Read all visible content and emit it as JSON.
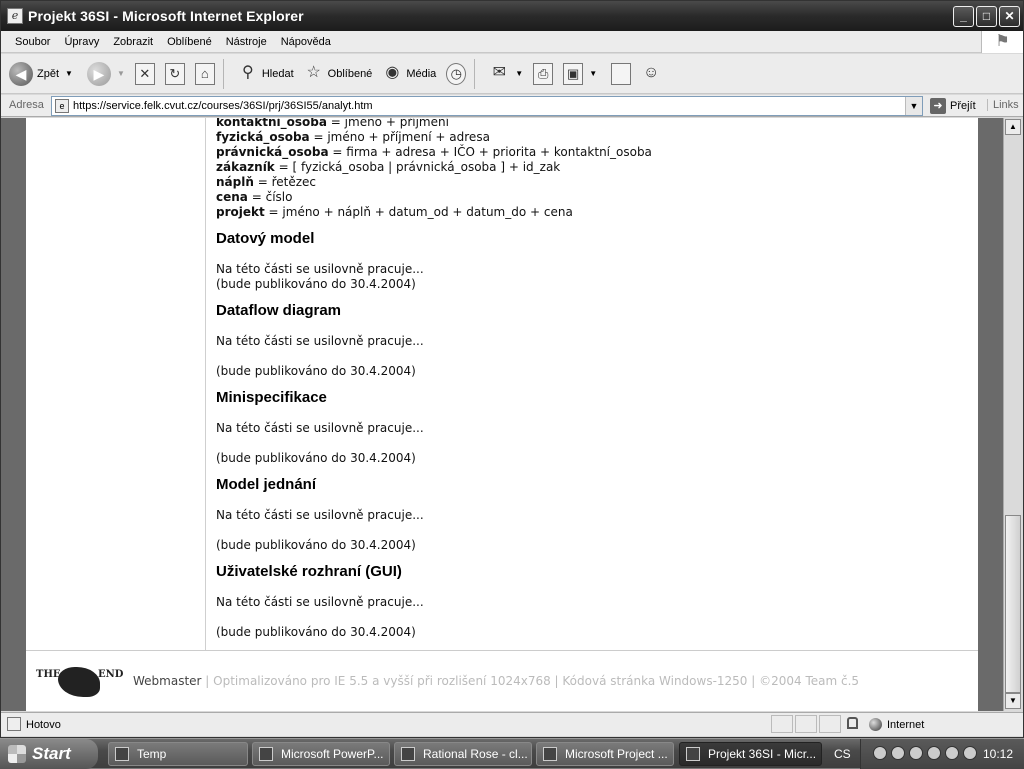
{
  "window": {
    "title": "Projekt 36SI - Microsoft Internet Explorer"
  },
  "menu": [
    "Soubor",
    "Úpravy",
    "Zobrazit",
    "Oblíbené",
    "Nástroje",
    "Nápověda"
  ],
  "toolbar": {
    "back": "Zpět",
    "search": "Hledat",
    "favorites": "Oblíbené",
    "media": "Média"
  },
  "address": {
    "label": "Adresa",
    "url": "https://service.felk.cvut.cz/courses/36SI/prj/36SI55/analyt.htm",
    "go": "Přejít",
    "links": "Links"
  },
  "content": {
    "definitions": [
      {
        "term": "kontaktní_osoba",
        "def": " = jméno + příjmení"
      },
      {
        "term": "fyzická_osoba",
        "def": " = jméno + příjmení + adresa"
      },
      {
        "term": "právnická_osoba",
        "def": " = firma + adresa + IČO + priorita + kontaktní_osoba"
      },
      {
        "term": "zákazník",
        "def": " = [ fyzická_osoba | právnická_osoba ] + id_zak"
      },
      {
        "term": "náplň",
        "def": " = řetězec"
      },
      {
        "term": "cena",
        "def": " = číslo"
      },
      {
        "term": "projekt",
        "def": " = jméno + náplň + datum_od + datum_do + cena"
      }
    ],
    "sections": [
      {
        "heading": "Datový model",
        "line1": "Na této části se usilovně pracuje...",
        "line2": "(bude publikováno do 30.4.2004)"
      },
      {
        "heading": "Dataflow diagram",
        "line1": "Na této části se usilovně pracuje...",
        "line2": "(bude publikováno do 30.4.2004)"
      },
      {
        "heading": "Minispecifikace",
        "line1": "Na této části se usilovně pracuje...",
        "line2": "(bude publikováno do 30.4.2004)"
      },
      {
        "heading": "Model jednání",
        "line1": "Na této části se usilovně pracuje...",
        "line2": "(bude publikováno do 30.4.2004)"
      },
      {
        "heading": "Uživatelské rozhraní (GUI)",
        "line1": "Na této části se usilovně pracuje...",
        "line2": "(bude publikováno do 30.4.2004)"
      }
    ]
  },
  "footer": {
    "logo_left": "THE",
    "logo_right": "END",
    "webmaster": "Webmaster",
    "info": " | Optimalizováno pro IE 5.5 a vyšší při rozlišení 1024x768 | Kódová stránka Windows-1250 | ©2004 Team č.5"
  },
  "status": {
    "text": "Hotovo",
    "zone": "Internet"
  },
  "taskbar": {
    "start": "Start",
    "tasks": [
      "Temp",
      "Microsoft PowerP...",
      "Rational Rose - cl...",
      "Microsoft Project ...",
      "Projekt 36SI - Micr..."
    ],
    "lang": "CS",
    "clock": "10:12"
  }
}
